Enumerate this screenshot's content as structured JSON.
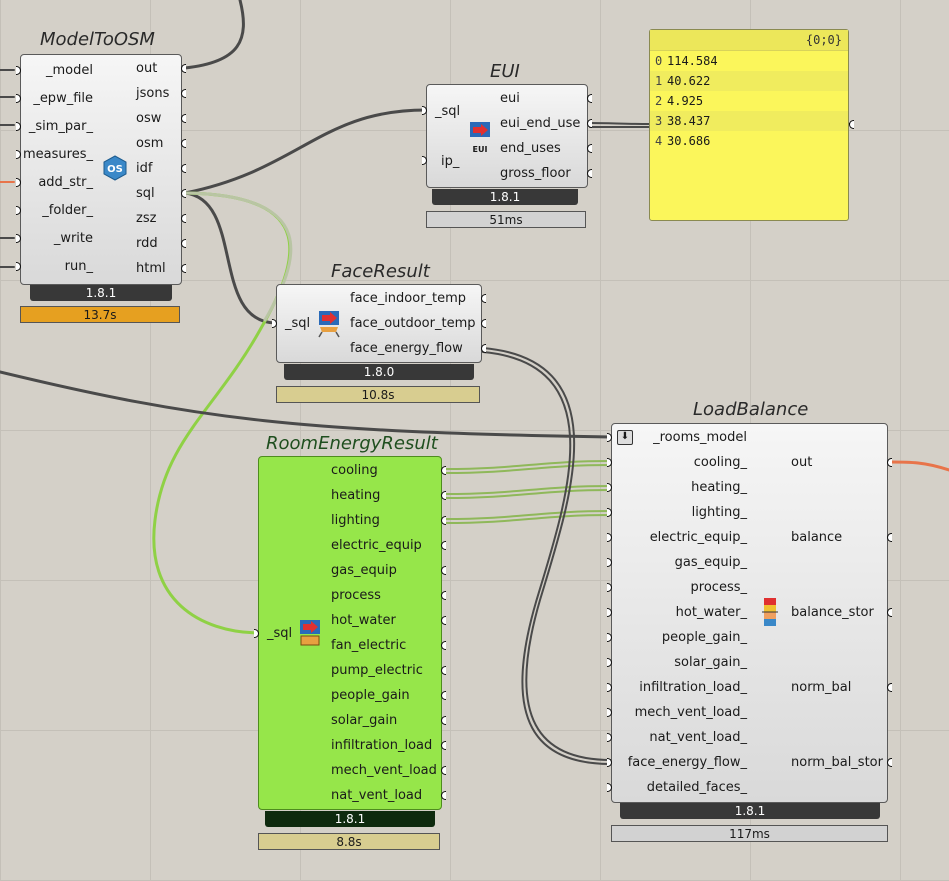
{
  "components": {
    "model_to_osm": {
      "title": "ModelToOSM",
      "inputs": [
        "_model",
        "_epw_file",
        "_sim_par_",
        "measures_",
        "add_str_",
        "_folder_",
        "_write",
        "run_"
      ],
      "outputs": [
        "out",
        "jsons",
        "osw",
        "osm",
        "idf",
        "sql",
        "zsz",
        "rdd",
        "html"
      ],
      "version": "1.8.1",
      "time": "13.7s"
    },
    "eui": {
      "title": "EUI",
      "inputs": [
        "_sql",
        "ip_"
      ],
      "outputs": [
        "eui",
        "eui_end_use",
        "end_uses",
        "gross_floor"
      ],
      "version": "1.8.1",
      "time": "51ms",
      "icon_label": "EUI"
    },
    "face_result": {
      "title": "FaceResult",
      "inputs": [
        "_sql"
      ],
      "outputs": [
        "face_indoor_temp",
        "face_outdoor_temp",
        "face_energy_flow"
      ],
      "version": "1.8.0",
      "time": "10.8s"
    },
    "room_energy_result": {
      "title": "RoomEnergyResult",
      "inputs": [
        "_sql"
      ],
      "outputs": [
        "cooling",
        "heating",
        "lighting",
        "electric_equip",
        "gas_equip",
        "process",
        "hot_water",
        "fan_electric",
        "pump_electric",
        "people_gain",
        "solar_gain",
        "infiltration_load",
        "mech_vent_load",
        "nat_vent_load"
      ],
      "version": "1.8.1",
      "time": "8.8s"
    },
    "load_balance": {
      "title": "LoadBalance",
      "inputs": [
        "_rooms_model",
        "cooling_",
        "heating_",
        "lighting_",
        "electric_equip_",
        "gas_equip_",
        "process_",
        "hot_water_",
        "people_gain_",
        "solar_gain_",
        "infiltration_load_",
        "mech_vent_load_",
        "nat_vent_load_",
        "face_energy_flow_",
        "detailed_faces_"
      ],
      "outputs": [
        "out",
        "balance",
        "balance_stor",
        "norm_bal",
        "norm_bal_stor"
      ],
      "version": "1.8.1",
      "time": "117ms"
    }
  },
  "panel": {
    "header": "{0;0}",
    "rows": [
      {
        "index": "0",
        "value": "114.584"
      },
      {
        "index": "1",
        "value": "40.622"
      },
      {
        "index": "2",
        "value": "4.925"
      },
      {
        "index": "3",
        "value": "38.437"
      },
      {
        "index": "4",
        "value": "30.686"
      }
    ]
  },
  "colors": {
    "canvas": "#d4d0c8",
    "wire": "#4a4a4a",
    "selected_wire": "#8fd145",
    "warning": "#e6a020",
    "panel": "#fbf65b",
    "data_out_wire": "#e8744a"
  }
}
